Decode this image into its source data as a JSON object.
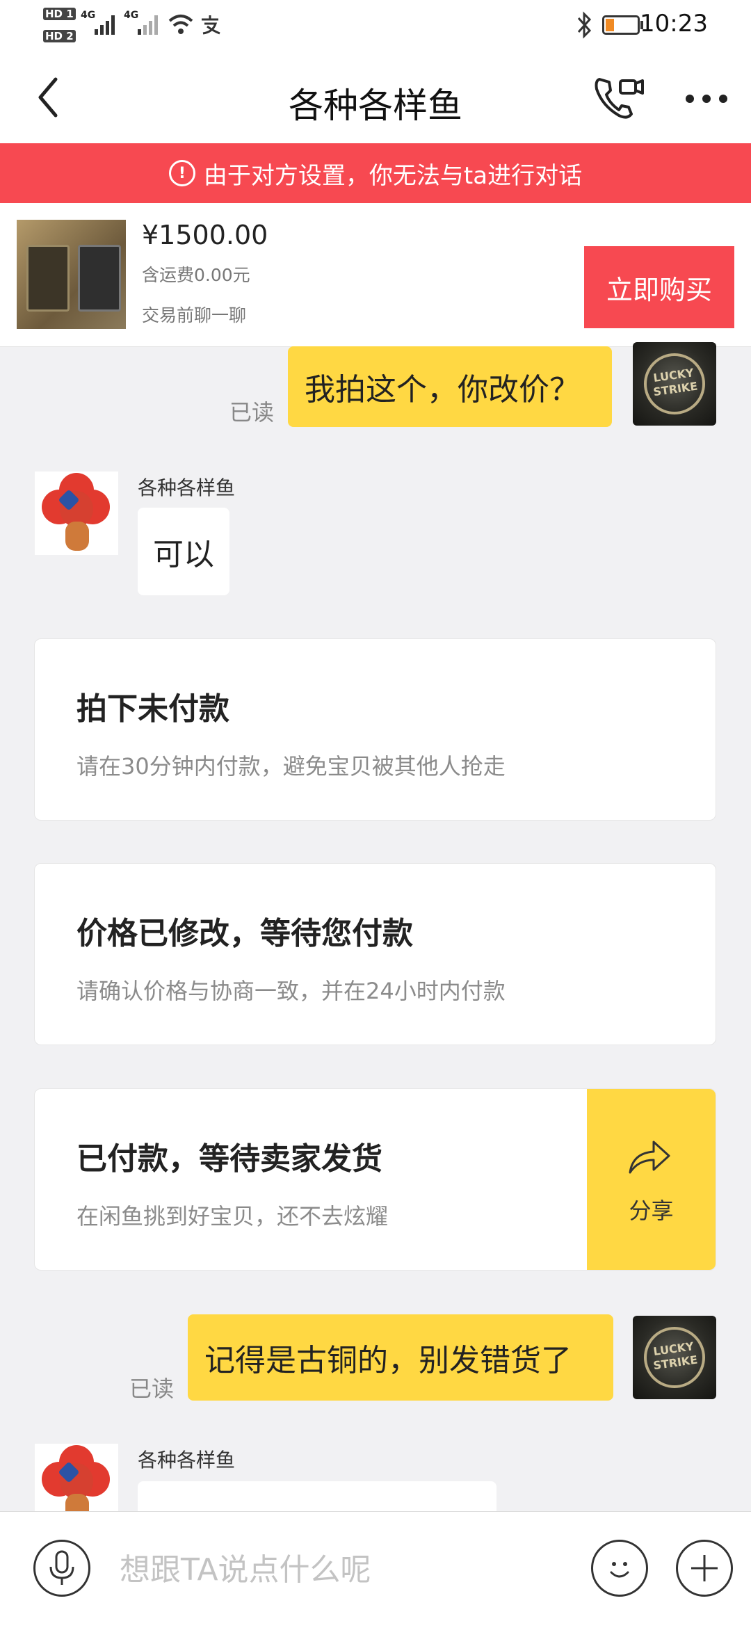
{
  "status_bar": {
    "hd1": "HD 1",
    "hd2": "HD 2",
    "net1": "4G",
    "net2": "4G",
    "time": "10:23"
  },
  "header": {
    "title": "各种各样鱼"
  },
  "banner": {
    "text": "由于对方设置，你无法与ta进行对话"
  },
  "product": {
    "price": "¥1500.00",
    "shipping": "含运费0.00元",
    "hint": "交易前聊一聊",
    "buy_label": "立即购买"
  },
  "messages": [
    {
      "side": "right",
      "text": "我拍这个，你改价？",
      "read": "已读"
    },
    {
      "side": "left",
      "sender": "各种各样鱼",
      "text": "可以"
    },
    {
      "side": "right",
      "text": "记得是古铜的，别发错货了",
      "read": "已读"
    },
    {
      "side": "left",
      "sender": "各种各样鱼",
      "text": ""
    }
  ],
  "avatar_text": "LUCKY STRIKE",
  "cards": [
    {
      "title": "拍下未付款",
      "subtitle": "请在30分钟内付款，避免宝贝被其他人抢走"
    },
    {
      "title": "价格已修改，等待您付款",
      "subtitle": "请确认价格与协商一致，并在24小时内付款"
    },
    {
      "title": "已付款，等待卖家发货",
      "subtitle": "在闲鱼挑到好宝贝，还不去炫耀",
      "action": "分享"
    }
  ],
  "input": {
    "placeholder": "想跟TA说点什么呢"
  },
  "colors": {
    "accent_yellow": "#ffd843",
    "alert_red": "#f74951",
    "background": "#f1f1f3"
  }
}
